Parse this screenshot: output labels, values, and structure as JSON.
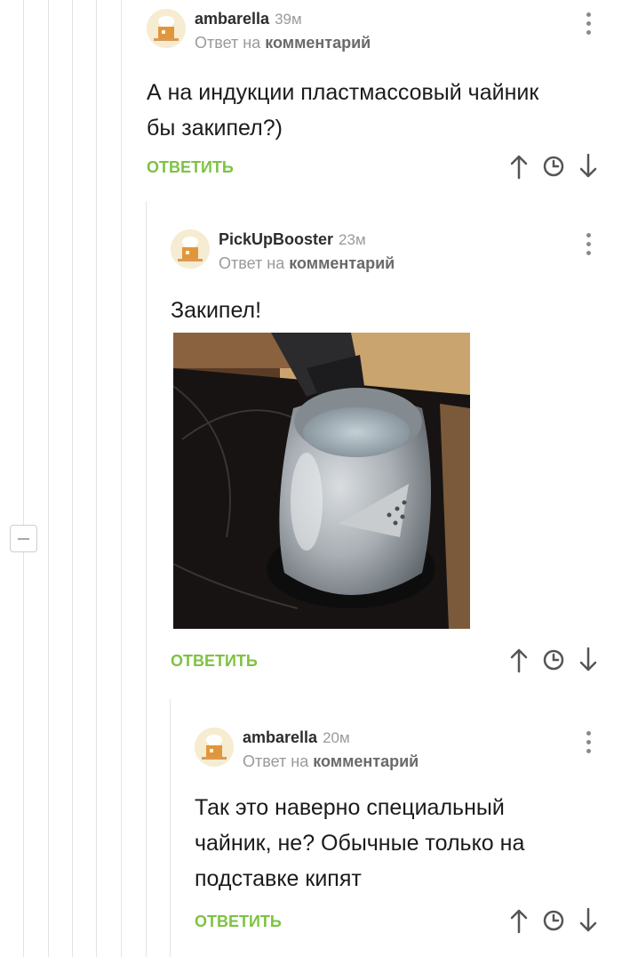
{
  "comments": [
    {
      "author": "ambarella",
      "time": "39м",
      "reply_prefix": "Ответ на",
      "reply_link": "комментарий",
      "text_lines": [
        "А на индукции пластмассовый чайник",
        "бы закипел?)"
      ],
      "reply_button": "ОТВЕТИТЬ"
    },
    {
      "author": "PickUpBooster",
      "time": "23м",
      "reply_prefix": "Ответ на",
      "reply_link": "комментарий",
      "text_lines": [
        "Закипел!"
      ],
      "image_alt": "stainless-steel-kettle-on-induction-hob-photo",
      "reply_button": "ОТВЕТИТЬ"
    },
    {
      "author": "ambarella",
      "time": "20м",
      "reply_prefix": "Ответ на",
      "reply_link": "комментарий",
      "text_lines": [
        "Так это наверно специальный",
        "чайник, не? Обычные только на",
        "подставке кипят"
      ],
      "reply_button": "ОТВЕТИТЬ"
    }
  ],
  "icons": {
    "more": "more-vertical-icon",
    "up": "arrow-up-icon",
    "clock": "clock-icon",
    "down": "arrow-down-icon",
    "collapse": "minus-icon"
  },
  "colors": {
    "reply_button": "#7ec242",
    "author": "#2d2d2d",
    "meta": "#9a9a9a",
    "thread_line": "#e3e3e3"
  }
}
